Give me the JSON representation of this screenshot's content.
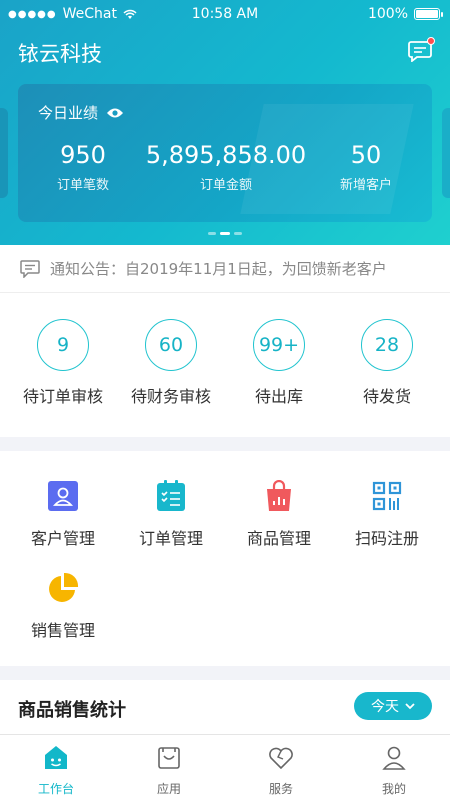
{
  "status_bar": {
    "carrier": "WeChat",
    "time": "10:58 AM",
    "battery": "100%"
  },
  "header": {
    "title": "铱云科技"
  },
  "performance": {
    "label": "今日业绩",
    "stats": [
      {
        "value": "950",
        "label": "订单笔数"
      },
      {
        "value": "5,895,858.00",
        "label": "订单金额"
      },
      {
        "value": "50",
        "label": "新增客户"
      }
    ]
  },
  "notice": {
    "text": "通知公告：自2019年11月1日起，为回馈新老客户"
  },
  "pending": [
    {
      "count": "9",
      "label": "待订单审核"
    },
    {
      "count": "60",
      "label": "待财务审核"
    },
    {
      "count": "99+",
      "label": "待出库"
    },
    {
      "count": "28",
      "label": "待发货"
    }
  ],
  "functions": [
    {
      "label": "客户管理",
      "icon": "customer-icon",
      "color": "#5b6cf0"
    },
    {
      "label": "订单管理",
      "icon": "order-icon",
      "color": "#18b7cc"
    },
    {
      "label": "商品管理",
      "icon": "goods-bag-icon",
      "color": "#f0595d"
    },
    {
      "label": "扫码注册",
      "icon": "qr-code-icon",
      "color": "#2f95d8"
    },
    {
      "label": "销售管理",
      "icon": "pie-chart-icon",
      "color": "#f7b500"
    }
  ],
  "sales_stats": {
    "title": "商品销售统计",
    "range": "今天"
  },
  "tabbar": [
    {
      "label": "工作台",
      "icon": "workbench-icon",
      "active": true
    },
    {
      "label": "应用",
      "icon": "apps-icon",
      "active": false
    },
    {
      "label": "服务",
      "icon": "service-heart-icon",
      "active": false
    },
    {
      "label": "我的",
      "icon": "profile-icon",
      "active": false
    }
  ],
  "colors": {
    "accent": "#18b7cc",
    "header_start": "#1aa3c8",
    "header_end": "#1fd0cf"
  }
}
